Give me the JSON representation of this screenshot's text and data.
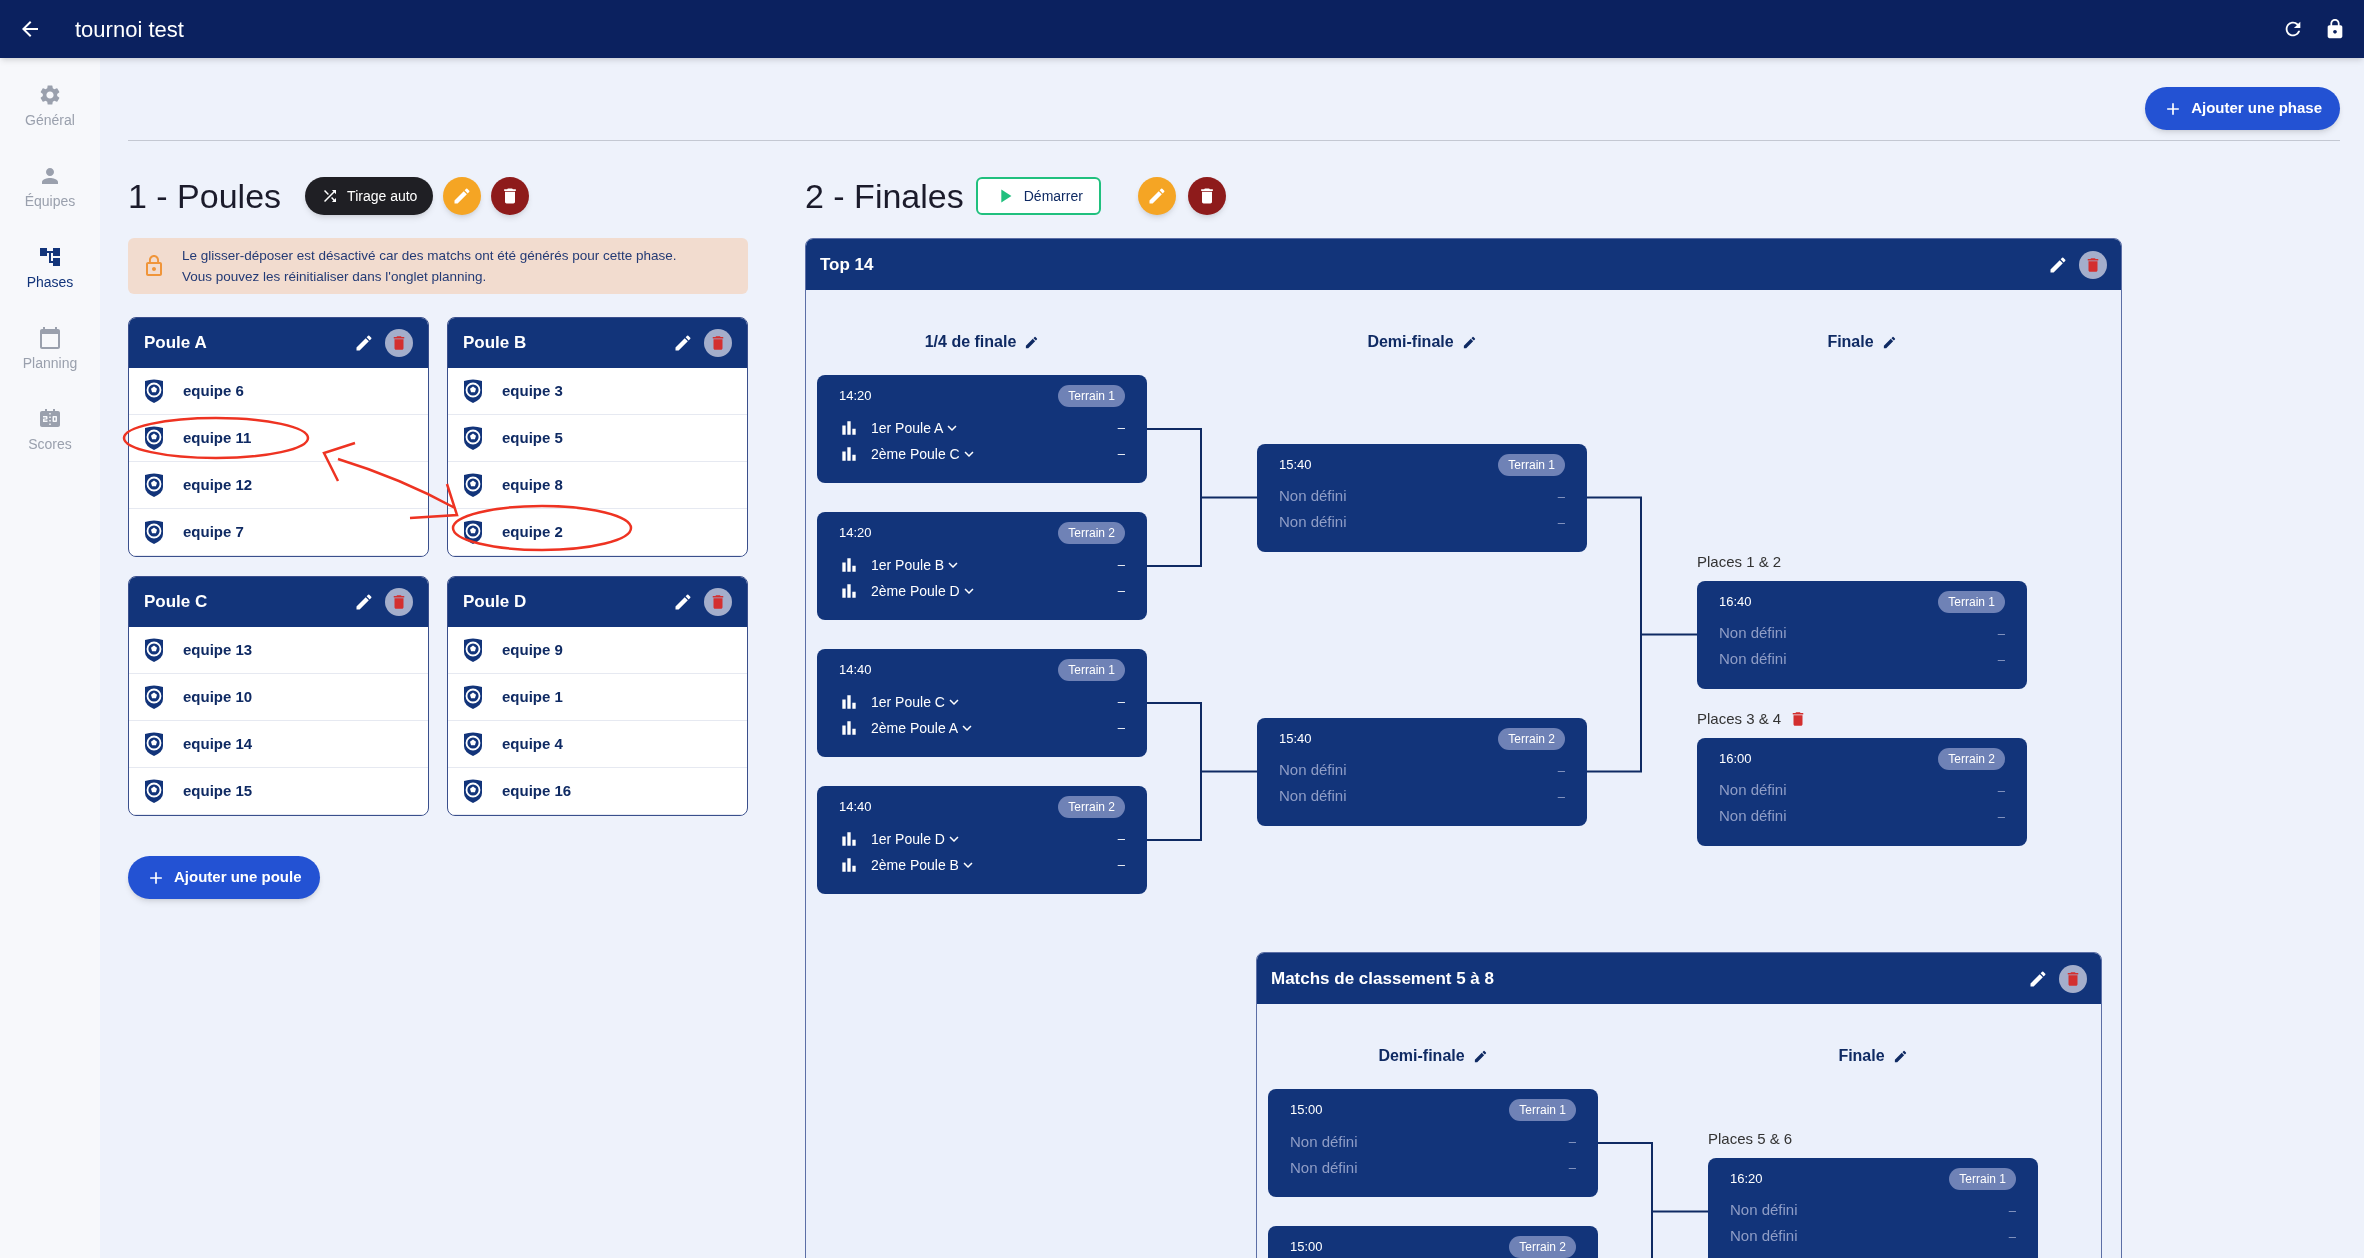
{
  "app_bar": {
    "title": "tournoi test"
  },
  "sidebar": {
    "items": [
      {
        "label": "Général",
        "selected": false
      },
      {
        "label": "Équipes",
        "selected": false
      },
      {
        "label": "Phases",
        "selected": true
      },
      {
        "label": "Planning",
        "selected": false
      },
      {
        "label": "Scores",
        "selected": false
      }
    ]
  },
  "add_phase_button": "Ajouter une phase",
  "pools_phase": {
    "title": "1 - Poules",
    "draw_button": "Tirage auto",
    "notice": "Le glisser-déposer est désactivé car des matchs ont été générés pour cette phase.\nVous pouvez les réinitialiser dans l'onglet planning.",
    "pools": [
      {
        "name": "Poule A",
        "teams": [
          "equipe 6",
          "equipe 11",
          "equipe 12",
          "equipe 7"
        ]
      },
      {
        "name": "Poule B",
        "teams": [
          "equipe 3",
          "equipe 5",
          "equipe 8",
          "equipe 2"
        ]
      },
      {
        "name": "Poule C",
        "teams": [
          "equipe 13",
          "equipe 10",
          "equipe 14",
          "equipe 15"
        ]
      },
      {
        "name": "Poule D",
        "teams": [
          "equipe 9",
          "equipe 1",
          "equipe 4",
          "equipe 16"
        ]
      }
    ],
    "add_pool_button": "Ajouter une poule"
  },
  "finals_phase": {
    "title": "2 - Finales",
    "start_button": "Démarrer",
    "brackets": [
      {
        "title": "Top 14",
        "rounds": [
          {
            "title": "1/4 de finale",
            "matches": [
              {
                "time": "14:20",
                "court": "Terrain 1",
                "teams": [
                  {
                    "kind": "seed",
                    "name": "1er Poule A",
                    "score": "–"
                  },
                  {
                    "kind": "seed",
                    "name": "2ème Poule C",
                    "score": "–"
                  }
                ]
              },
              {
                "time": "14:20",
                "court": "Terrain 2",
                "teams": [
                  {
                    "kind": "seed",
                    "name": "1er Poule B",
                    "score": "–"
                  },
                  {
                    "kind": "seed",
                    "name": "2ème Poule D",
                    "score": "–"
                  }
                ]
              },
              {
                "time": "14:40",
                "court": "Terrain 1",
                "teams": [
                  {
                    "kind": "seed",
                    "name": "1er Poule C",
                    "score": "–"
                  },
                  {
                    "kind": "seed",
                    "name": "2ème Poule A",
                    "score": "–"
                  }
                ]
              },
              {
                "time": "14:40",
                "court": "Terrain 2",
                "teams": [
                  {
                    "kind": "seed",
                    "name": "1er Poule D",
                    "score": "–"
                  },
                  {
                    "kind": "seed",
                    "name": "2ème Poule B",
                    "score": "–"
                  }
                ]
              }
            ]
          },
          {
            "title": "Demi-finale",
            "matches": [
              {
                "time": "15:40",
                "court": "Terrain 1",
                "teams": [
                  {
                    "kind": "placeholder",
                    "name": "Non défini",
                    "score": "–"
                  },
                  {
                    "kind": "placeholder",
                    "name": "Non défini",
                    "score": "–"
                  }
                ]
              },
              {
                "time": "15:40",
                "court": "Terrain 2",
                "teams": [
                  {
                    "kind": "placeholder",
                    "name": "Non défini",
                    "score": "–"
                  },
                  {
                    "kind": "placeholder",
                    "name": "Non défini",
                    "score": "–"
                  }
                ]
              }
            ]
          },
          {
            "title": "Finale",
            "matches": [
              {
                "label": "Places 1 & 2",
                "deletable": false,
                "time": "16:40",
                "court": "Terrain 1",
                "teams": [
                  {
                    "kind": "placeholder",
                    "name": "Non défini",
                    "score": "–"
                  },
                  {
                    "kind": "placeholder",
                    "name": "Non défini",
                    "score": "–"
                  }
                ]
              },
              {
                "label": "Places 3 & 4",
                "deletable": true,
                "time": "16:00",
                "court": "Terrain 2",
                "teams": [
                  {
                    "kind": "placeholder",
                    "name": "Non défini",
                    "score": "–"
                  },
                  {
                    "kind": "placeholder",
                    "name": "Non défini",
                    "score": "–"
                  }
                ]
              }
            ]
          }
        ]
      },
      {
        "title": "Matchs de classement 5 à 8",
        "rounds": [
          {
            "title": "Demi-finale",
            "matches": [
              {
                "time": "15:00",
                "court": "Terrain 1",
                "teams": [
                  {
                    "kind": "placeholder",
                    "name": "Non défini",
                    "score": "–"
                  },
                  {
                    "kind": "placeholder",
                    "name": "Non défini",
                    "score": "–"
                  }
                ]
              },
              {
                "time": "15:00",
                "court": "Terrain 2"
              }
            ]
          },
          {
            "title": "Finale",
            "matches": [
              {
                "label": "Places 5 & 6",
                "deletable": false,
                "time": "16:20",
                "court": "Terrain 1",
                "teams": [
                  {
                    "kind": "placeholder",
                    "name": "Non défini",
                    "score": "–"
                  },
                  {
                    "kind": "placeholder",
                    "name": "Non défini",
                    "score": "–"
                  }
                ]
              }
            ]
          }
        ]
      }
    ]
  }
}
